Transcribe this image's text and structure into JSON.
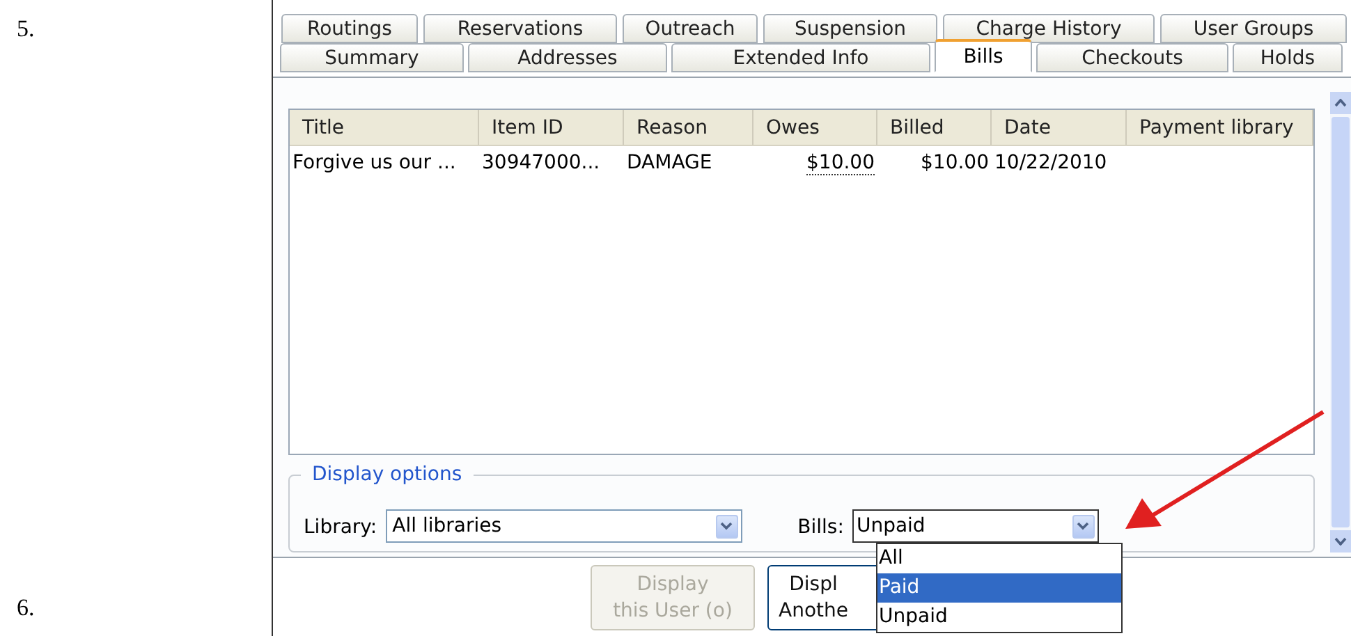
{
  "doc_markers": [
    "5.",
    "6."
  ],
  "tab_rows": [
    [
      {
        "label": "Routings",
        "selected": false
      },
      {
        "label": "Reservations",
        "selected": false
      },
      {
        "label": "Outreach",
        "selected": false
      },
      {
        "label": "Suspension",
        "selected": false
      },
      {
        "label": "Charge History",
        "selected": false
      },
      {
        "label": "User Groups",
        "selected": false
      }
    ],
    [
      {
        "label": "Summary",
        "selected": false
      },
      {
        "label": "Addresses",
        "selected": false
      },
      {
        "label": "Extended Info",
        "selected": false
      },
      {
        "label": "Bills",
        "selected": true
      },
      {
        "label": "Checkouts",
        "selected": false
      },
      {
        "label": "Holds",
        "selected": false
      }
    ]
  ],
  "table": {
    "columns": [
      "Title",
      "Item ID",
      "Reason",
      "Owes",
      "Billed",
      "Date",
      "Payment library"
    ],
    "rows": [
      {
        "cells": [
          "Forgive us our ...",
          "30947000...",
          "DAMAGE",
          "$10.00",
          "$10.00",
          "10/22/2010"
        ]
      }
    ]
  },
  "display_options": {
    "legend": "Display options",
    "library": {
      "label": "Library:",
      "value": "All libraries"
    },
    "bills": {
      "label": "Bills:",
      "value": "Unpaid",
      "expanded": true,
      "options": [
        {
          "label": "All",
          "highlighted": false
        },
        {
          "label": "Paid",
          "highlighted": true
        },
        {
          "label": "Unpaid",
          "highlighted": false
        }
      ]
    }
  },
  "buttons": [
    {
      "lines": [
        "Display",
        "this User (o)"
      ],
      "disabled": true
    },
    {
      "lines": [
        "Displ",
        "Anothe"
      ],
      "disabled": false
    }
  ]
}
